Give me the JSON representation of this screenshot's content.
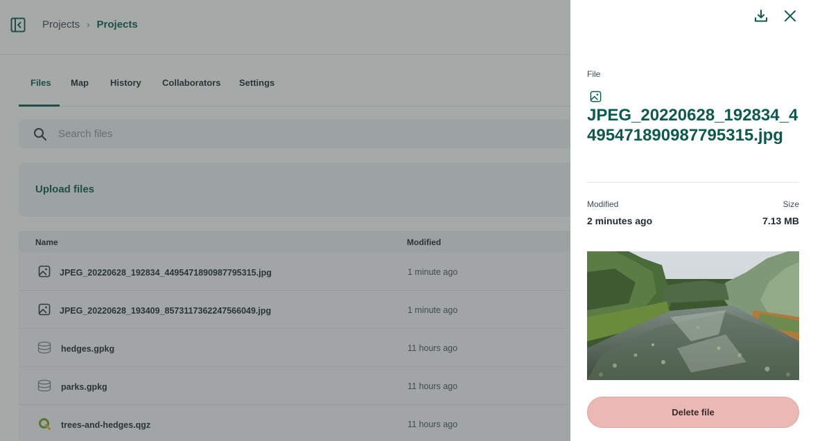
{
  "breadcrumb": {
    "items": [
      "Projects",
      "Projects"
    ],
    "separator": "›"
  },
  "tabs": [
    {
      "label": "Files"
    },
    {
      "label": "Map"
    },
    {
      "label": "History"
    },
    {
      "label": "Collaborators"
    },
    {
      "label": "Settings"
    }
  ],
  "active_tab": "Files",
  "search": {
    "placeholder": "Search files",
    "value": ""
  },
  "upload": {
    "label": "Upload files"
  },
  "table": {
    "headers": {
      "name": "Name",
      "modified": "Modified"
    },
    "rows": [
      {
        "icon": "image-icon",
        "name": "JPEG_20220628_192834_4495471890987795315.jpg",
        "modified": "1 minute ago"
      },
      {
        "icon": "image-icon",
        "name": "JPEG_20220628_193409_8573117362247566049.jpg",
        "modified": "1 minute ago"
      },
      {
        "icon": "database-icon",
        "name": "hedges.gpkg",
        "modified": "11 hours ago"
      },
      {
        "icon": "database-icon",
        "name": "parks.gpkg",
        "modified": "11 hours ago"
      },
      {
        "icon": "qgis-icon",
        "name": "trees-and-hedges.qgz",
        "modified": "11 hours ago"
      }
    ]
  },
  "drawer": {
    "section_label": "File",
    "file_icon": "image-icon",
    "file_name": "JPEG_20220628_192834_4495471890987795315.jpg",
    "modified_label": "Modified",
    "modified_value": "2 minutes ago",
    "size_label": "Size",
    "size_value": "7.13 MB",
    "preview": "photo of a canal with water lilies and trees",
    "delete_label": "Delete file",
    "icons": {
      "download": "download-icon",
      "close": "close-icon"
    }
  },
  "colors": {
    "accent": "#0c5a4f",
    "overlay": "#37413e",
    "delete_button": "#ebb9b4",
    "qgis_green": "#6fa42a"
  }
}
